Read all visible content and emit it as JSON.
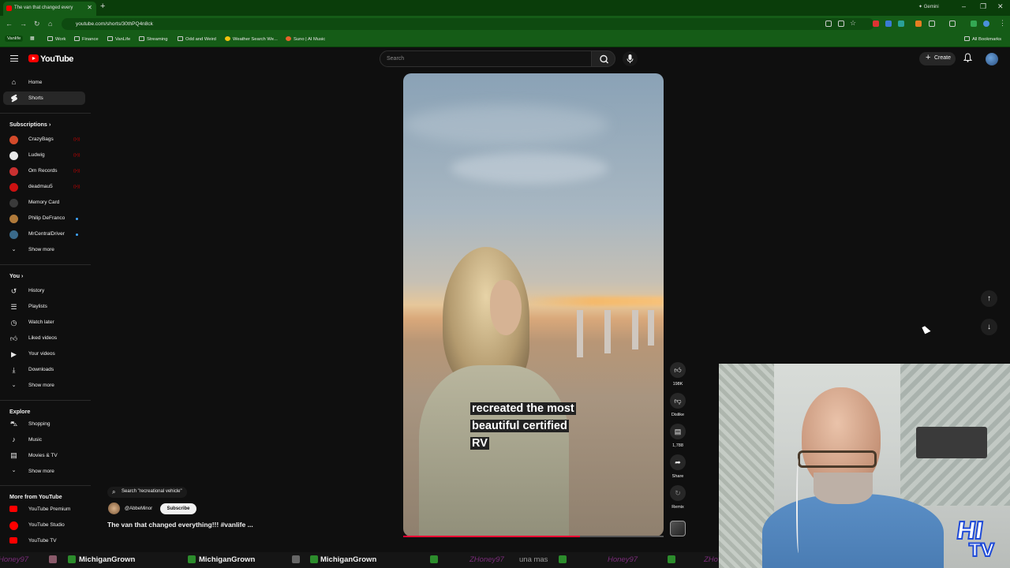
{
  "browser": {
    "tab_title": "The van that changed every",
    "url": "youtube.com/shorts/30thPQ4n8ck",
    "gemini_label": "Gemini",
    "bookmarks": [
      "Vanlife",
      "Work",
      "Finance",
      "VanLife",
      "Streaming",
      "Odd and Weird",
      "Weather Search We...",
      "Suno | AI Music"
    ],
    "all_bookmarks": "All Bookmarks"
  },
  "header": {
    "logo_text": "YouTube",
    "search_placeholder": "Search",
    "create_label": "Create"
  },
  "sidebar": {
    "main": [
      {
        "label": "Home",
        "icon": "home-icon"
      },
      {
        "label": "Shorts",
        "icon": "shorts-icon",
        "active": true
      }
    ],
    "subscriptions_heading": "Subscriptions",
    "subscriptions": [
      {
        "label": "CrazyBags",
        "color": "#d44a2a",
        "status": "live"
      },
      {
        "label": "Ludwig",
        "color": "#e8e8e8",
        "status": "live"
      },
      {
        "label": "Om Records",
        "color": "#c93030",
        "status": "live"
      },
      {
        "label": "deadmau5",
        "color": "#cc1111",
        "status": "live"
      },
      {
        "label": "Memory Card",
        "color": "#3a3a3a",
        "status": ""
      },
      {
        "label": "Philip DeFranco",
        "color": "#b07a3a",
        "status": "dot"
      },
      {
        "label": "MrCentralDriver",
        "color": "#3a6a8a",
        "status": "dot"
      }
    ],
    "show_more": "Show more",
    "you_heading": "You",
    "you_items": [
      {
        "label": "History",
        "icon": "history-icon"
      },
      {
        "label": "Playlists",
        "icon": "playlists-icon"
      },
      {
        "label": "Watch later",
        "icon": "watch-later-icon"
      },
      {
        "label": "Liked videos",
        "icon": "liked-videos-icon"
      },
      {
        "label": "Your videos",
        "icon": "your-videos-icon"
      },
      {
        "label": "Downloads",
        "icon": "downloads-icon"
      }
    ],
    "explore_heading": "Explore",
    "explore_items": [
      {
        "label": "Shopping",
        "icon": "shopping-icon"
      },
      {
        "label": "Music",
        "icon": "music-icon"
      },
      {
        "label": "Movies & TV",
        "icon": "movies-icon"
      }
    ],
    "more_heading": "More from YouTube",
    "more_items": [
      {
        "label": "YouTube Premium"
      },
      {
        "label": "YouTube Studio"
      },
      {
        "label": "YouTube TV"
      }
    ]
  },
  "short": {
    "caption_lines": [
      "recreated the most",
      "beautiful certified",
      "RV"
    ],
    "search_chip": "Search \"recreational vehicle\"",
    "channel": "@AbbeMinor",
    "subscribe_label": "Subscribe",
    "title": "The van that changed everything!!! #vanlife ...",
    "progress": 0.68,
    "actions": {
      "like_count": "198K",
      "dislike_label": "Dislike",
      "comments_count": "1,788",
      "share_label": "Share",
      "remix_label": "Remix"
    }
  },
  "overlay": {
    "logo_line1": "HI",
    "logo_line2": "TV",
    "ticker_items": [
      "Honey97",
      "MichiganGrown",
      "MichiganGrown",
      "MichiganGrown",
      "ZHoney97",
      "una mas",
      "Honey97",
      "ZHo"
    ]
  }
}
